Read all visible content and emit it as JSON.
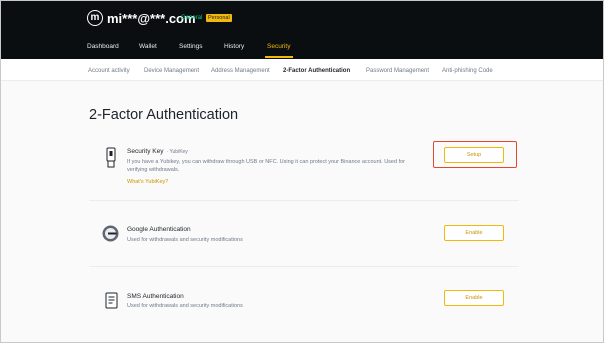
{
  "header": {
    "logo_letter": "m",
    "account": "mi***@***.com",
    "level": "General",
    "badge": "Personal"
  },
  "nav": [
    {
      "label": "Dashboard"
    },
    {
      "label": "Wallet"
    },
    {
      "label": "Settings"
    },
    {
      "label": "History"
    },
    {
      "label": "Security",
      "active": true
    }
  ],
  "subtabs": [
    {
      "label": "Account activity"
    },
    {
      "label": "Device Management"
    },
    {
      "label": "Address Management"
    },
    {
      "label": "2-Factor Authentication",
      "active": true
    },
    {
      "label": "Password Management"
    },
    {
      "label": "Anti-phishing Code"
    }
  ],
  "main": {
    "title": "2-Factor Authentication",
    "methods": [
      {
        "icon": "usb-key-icon",
        "title": "Security Key",
        "tag": "· YubiKey",
        "desc": "If you have a Yubikey, you can withdraw through USB or NFC. Using it can protect your Binance account. Used for verifying withdrawals.",
        "link": "What's YubiKey?",
        "button": "Setup",
        "highlighted": true
      },
      {
        "icon": "google-authenticator-icon",
        "title": "Google Authentication",
        "desc": "Used for withdrawals and security modifications",
        "button": "Enable"
      },
      {
        "icon": "sms-phone-icon",
        "title": "SMS Authentication",
        "desc": "Used for withdrawals and security modifications",
        "button": "Enable"
      }
    ]
  },
  "colors": {
    "brand": "#f0b90b",
    "header_bg": "#0b0e11",
    "highlight": "#e0482f",
    "level": "#0ecb81"
  }
}
